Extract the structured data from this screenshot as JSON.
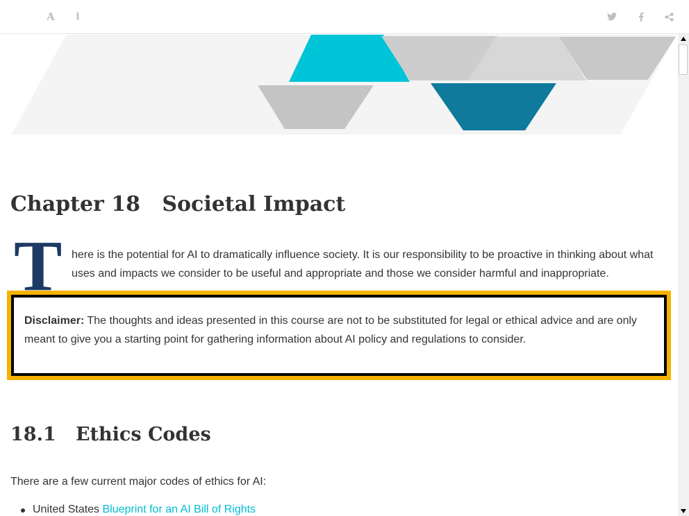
{
  "toolbar": {
    "left_buttons": [
      {
        "name": "font-settings-icon",
        "glyph": "A"
      },
      {
        "name": "info-icon",
        "glyph": "i"
      }
    ],
    "right_buttons": [
      {
        "name": "twitter-icon"
      },
      {
        "name": "facebook-icon"
      },
      {
        "name": "share-icon"
      }
    ],
    "icon_color": "#bdbdbd"
  },
  "chapter": {
    "title": "Chapter 18   Societal Impact",
    "dropcap": "T",
    "intro": "here is the potential for AI to dramatically influence society. It is our responsibility to be proactive in thinking about what uses and impacts we consider to be useful and appropriate and those we consider harmful and inappropriate."
  },
  "disclaimer": {
    "label": "Disclaimer:",
    "text": " The thoughts and ideas presented in this course are not to be substituted for legal or ethical advice and are only meant to give you a starting point for gathering information about AI policy and regulations to consider."
  },
  "section": {
    "title": "18.1   Ethics Codes",
    "intro": "There are a few current major codes of ethics for AI:",
    "items": [
      {
        "prefix": "United States ",
        "link": "Blueprint for an AI Bill of Rights"
      }
    ]
  },
  "colors": {
    "cyan": "#00c4d8",
    "teal": "#0f7a9c",
    "gray": "#c8c8c8",
    "highlight": "#f5b300",
    "dropcap": "#1c3a63",
    "link": "#00bcd4"
  }
}
